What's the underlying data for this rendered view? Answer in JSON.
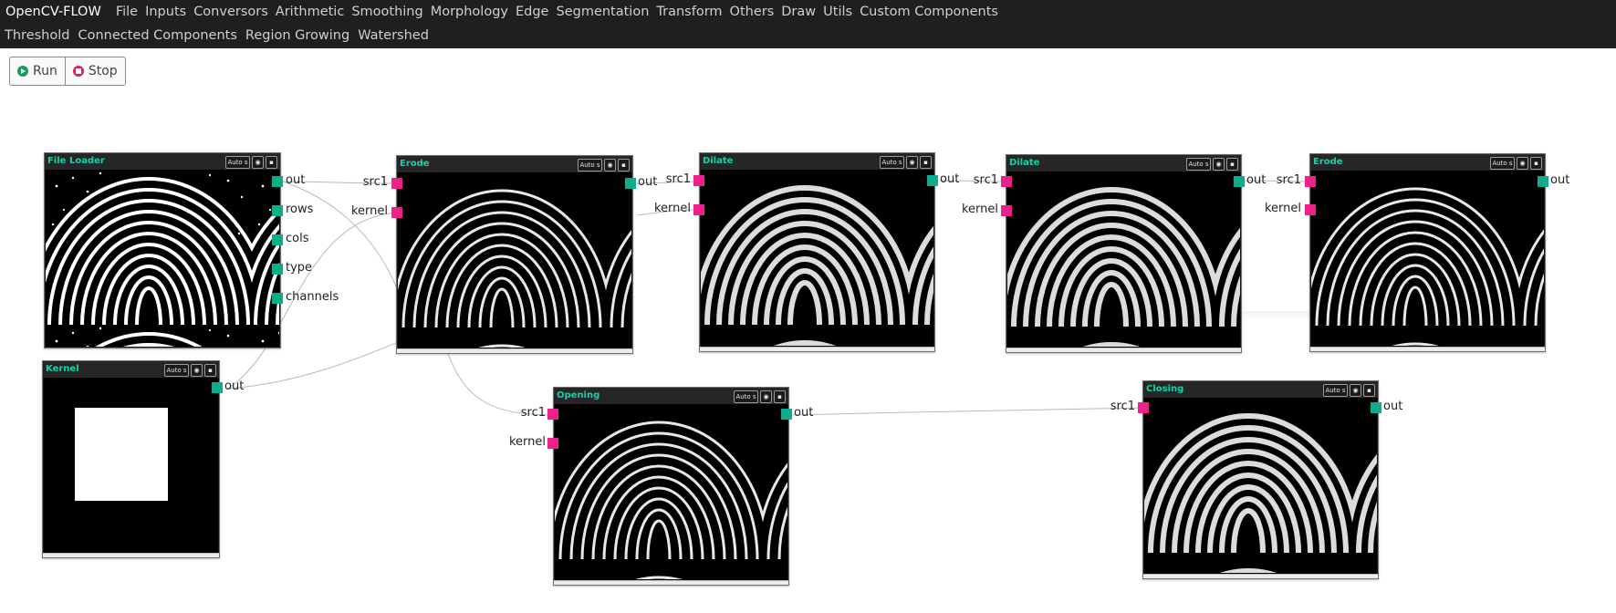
{
  "app": {
    "title": "OpenCV-FLOW"
  },
  "menu": {
    "row1": [
      "File",
      "Inputs",
      "Conversors",
      "Arithmetic",
      "Smoothing",
      "Morphology",
      "Edge",
      "Segmentation",
      "Transform",
      "Others",
      "Draw",
      "Utils",
      "Custom Components"
    ],
    "row2": [
      "Threshold",
      "Connected Components",
      "Region Growing",
      "Watershed"
    ]
  },
  "toolbar": {
    "run_label": "Run",
    "stop_label": "Stop"
  },
  "node_controls": {
    "auto_label": "Auto s",
    "view_icon": "eye-icon",
    "close_icon": "close-icon"
  },
  "ports": {
    "out": "out",
    "src1": "src1",
    "kernel": "kernel",
    "rows": "rows",
    "cols": "cols",
    "type": "type",
    "channels": "channels"
  },
  "nodes": {
    "file_loader": {
      "title": "File Loader",
      "image": "fingerprint-binary"
    },
    "kernel": {
      "title": "Kernel",
      "image": "white-square-kernel"
    },
    "erode1": {
      "title": "Erode",
      "image": "fingerprint-eroded"
    },
    "dilate1": {
      "title": "Dilate",
      "image": "fingerprint-dilated"
    },
    "dilate2": {
      "title": "Dilate",
      "image": "fingerprint-dilated"
    },
    "erode2": {
      "title": "Erode",
      "image": "fingerprint-eroded"
    },
    "opening": {
      "title": "Opening",
      "image": "fingerprint-opened"
    },
    "closing": {
      "title": "Closing",
      "image": "fingerprint-closed"
    }
  },
  "colors": {
    "input_port": "#f0208a",
    "output_port": "#0eac8c",
    "node_title": "#14d2a8",
    "menubar": "#1f1f1f"
  }
}
